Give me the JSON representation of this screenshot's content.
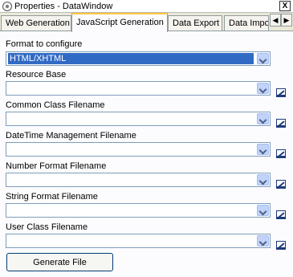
{
  "window": {
    "title": "Properties - DataWindow",
    "close_label": "X"
  },
  "tabs": [
    {
      "label": "Web Generation"
    },
    {
      "label": "JavaScript Generation",
      "active": true
    },
    {
      "label": "Data Export"
    },
    {
      "label": "Data Impo"
    }
  ],
  "tab_scroll": {
    "left": "◀",
    "right": "▶"
  },
  "form": {
    "format_to_configure": {
      "label": "Format to configure",
      "value": "HTML/XHTML"
    },
    "resource_base": {
      "label": "Resource Base",
      "value": ""
    },
    "common_class_filename": {
      "label": "Common Class Filename",
      "value": ""
    },
    "datetime_management_filename": {
      "label": "DateTime Management Filename",
      "value": ""
    },
    "number_format_filename": {
      "label": "Number Format Filename",
      "value": ""
    },
    "string_format_filename": {
      "label": "String Format Filename",
      "value": ""
    },
    "user_class_filename": {
      "label": "User Class Filename",
      "value": ""
    }
  },
  "buttons": {
    "generate_file": "Generate File"
  },
  "icons": {
    "app": "datawindow-app-icon",
    "close": "close-icon",
    "dropdown": "chevron-down-icon",
    "edit": "edit-pencil-icon"
  },
  "colors": {
    "selection": "#316ac5",
    "active_tab_accent": "#ffc83c",
    "panel_bg": "#fcfcfe",
    "window_bg": "#ece9d8"
  }
}
